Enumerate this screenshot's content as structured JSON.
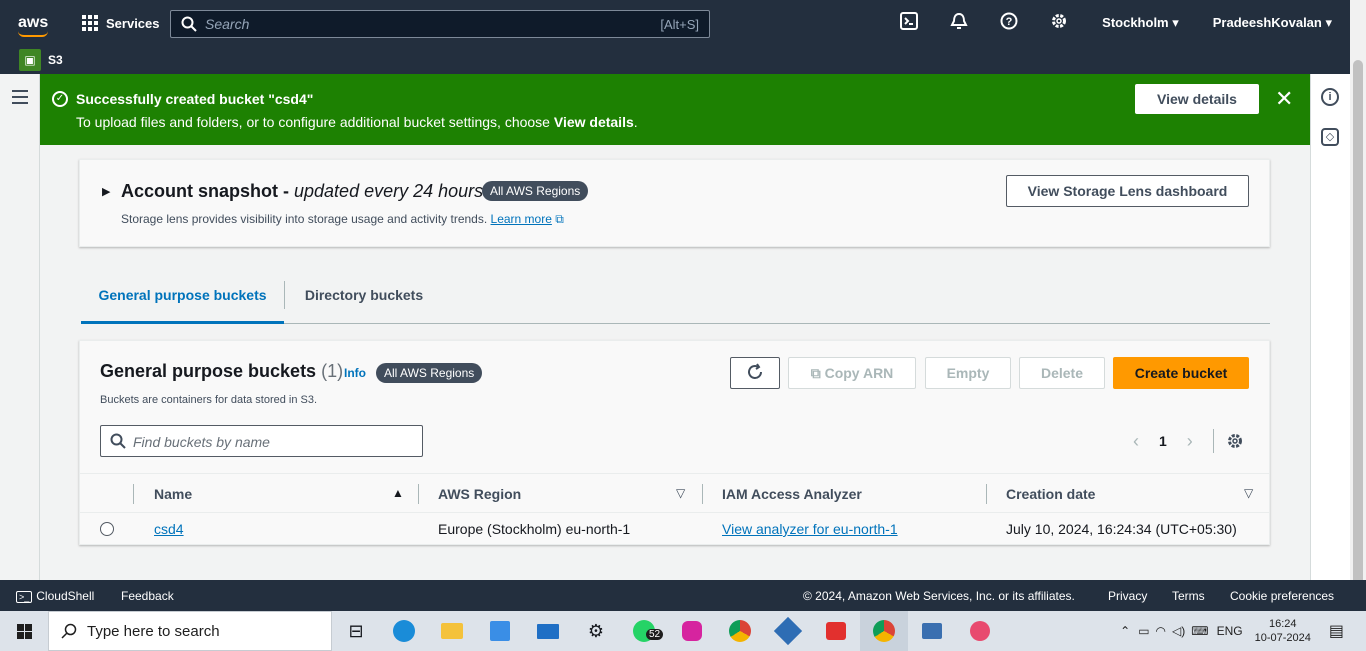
{
  "topnav": {
    "logo": "aws",
    "services_label": "Services",
    "search_placeholder": "Search",
    "search_shortcut": "[Alt+S]",
    "region": "Stockholm ▾",
    "user": "PradeeshKovalan ▾"
  },
  "service_bar": {
    "label": "S3"
  },
  "flash": {
    "title": "Successfully created bucket \"csd4\"",
    "message_prefix": "To upload files and folders, or to configure additional bucket settings, choose ",
    "message_bold": "View details",
    "message_suffix": ".",
    "view_details_label": "View details",
    "color": "#1d8102"
  },
  "snapshot": {
    "title": "Account snapshot - ",
    "title_italic": "updated every 24 hours",
    "regions_badge": "All AWS Regions",
    "description": "Storage lens provides visibility into storage usage and activity trends. ",
    "learn_more": "Learn more",
    "storage_lens_button": "View Storage Lens dashboard"
  },
  "tabs": [
    {
      "label": "General purpose buckets",
      "active": true
    },
    {
      "label": "Directory buckets",
      "active": false
    }
  ],
  "buckets_panel": {
    "title": "General purpose buckets",
    "count": "(1)",
    "info": "Info",
    "regions_badge": "All AWS Regions",
    "description": "Buckets are containers for data stored in S3.",
    "copy_arn": "Copy ARN",
    "empty": "Empty",
    "delete": "Delete",
    "create_bucket": "Create bucket",
    "search_placeholder": "Find buckets by name",
    "page": "1",
    "columns": [
      "Name",
      "AWS Region",
      "IAM Access Analyzer",
      "Creation date"
    ],
    "rows": [
      {
        "name": "csd4",
        "region": "Europe (Stockholm) eu-north-1",
        "analyzer": "View analyzer for eu-north-1",
        "created": "July 10, 2024, 16:24:34 (UTC+05:30)"
      }
    ],
    "accent": "#ff9900"
  },
  "footer": {
    "cloudshell": "CloudShell",
    "feedback": "Feedback",
    "copyright": "© 2024, Amazon Web Services, Inc. or its affiliates.",
    "privacy": "Privacy",
    "terms": "Terms",
    "cookies": "Cookie preferences"
  },
  "taskbar": {
    "search_placeholder": "Type here to search",
    "whatsapp_badge": "52",
    "lang": "ENG",
    "time": "16:24",
    "date": "10-07-2024"
  }
}
